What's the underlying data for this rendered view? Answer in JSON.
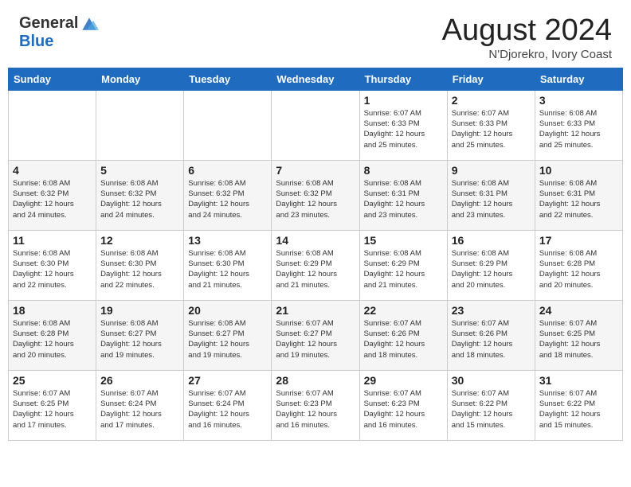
{
  "header": {
    "logo_general": "General",
    "logo_blue": "Blue",
    "month_title": "August 2024",
    "location": "N'Djorekro, Ivory Coast"
  },
  "days_of_week": [
    "Sunday",
    "Monday",
    "Tuesday",
    "Wednesday",
    "Thursday",
    "Friday",
    "Saturday"
  ],
  "weeks": [
    [
      {
        "day": "",
        "info": ""
      },
      {
        "day": "",
        "info": ""
      },
      {
        "day": "",
        "info": ""
      },
      {
        "day": "",
        "info": ""
      },
      {
        "day": "1",
        "info": "Sunrise: 6:07 AM\nSunset: 6:33 PM\nDaylight: 12 hours\nand 25 minutes."
      },
      {
        "day": "2",
        "info": "Sunrise: 6:07 AM\nSunset: 6:33 PM\nDaylight: 12 hours\nand 25 minutes."
      },
      {
        "day": "3",
        "info": "Sunrise: 6:08 AM\nSunset: 6:33 PM\nDaylight: 12 hours\nand 25 minutes."
      }
    ],
    [
      {
        "day": "4",
        "info": "Sunrise: 6:08 AM\nSunset: 6:32 PM\nDaylight: 12 hours\nand 24 minutes."
      },
      {
        "day": "5",
        "info": "Sunrise: 6:08 AM\nSunset: 6:32 PM\nDaylight: 12 hours\nand 24 minutes."
      },
      {
        "day": "6",
        "info": "Sunrise: 6:08 AM\nSunset: 6:32 PM\nDaylight: 12 hours\nand 24 minutes."
      },
      {
        "day": "7",
        "info": "Sunrise: 6:08 AM\nSunset: 6:32 PM\nDaylight: 12 hours\nand 23 minutes."
      },
      {
        "day": "8",
        "info": "Sunrise: 6:08 AM\nSunset: 6:31 PM\nDaylight: 12 hours\nand 23 minutes."
      },
      {
        "day": "9",
        "info": "Sunrise: 6:08 AM\nSunset: 6:31 PM\nDaylight: 12 hours\nand 23 minutes."
      },
      {
        "day": "10",
        "info": "Sunrise: 6:08 AM\nSunset: 6:31 PM\nDaylight: 12 hours\nand 22 minutes."
      }
    ],
    [
      {
        "day": "11",
        "info": "Sunrise: 6:08 AM\nSunset: 6:30 PM\nDaylight: 12 hours\nand 22 minutes."
      },
      {
        "day": "12",
        "info": "Sunrise: 6:08 AM\nSunset: 6:30 PM\nDaylight: 12 hours\nand 22 minutes."
      },
      {
        "day": "13",
        "info": "Sunrise: 6:08 AM\nSunset: 6:30 PM\nDaylight: 12 hours\nand 21 minutes."
      },
      {
        "day": "14",
        "info": "Sunrise: 6:08 AM\nSunset: 6:29 PM\nDaylight: 12 hours\nand 21 minutes."
      },
      {
        "day": "15",
        "info": "Sunrise: 6:08 AM\nSunset: 6:29 PM\nDaylight: 12 hours\nand 21 minutes."
      },
      {
        "day": "16",
        "info": "Sunrise: 6:08 AM\nSunset: 6:29 PM\nDaylight: 12 hours\nand 20 minutes."
      },
      {
        "day": "17",
        "info": "Sunrise: 6:08 AM\nSunset: 6:28 PM\nDaylight: 12 hours\nand 20 minutes."
      }
    ],
    [
      {
        "day": "18",
        "info": "Sunrise: 6:08 AM\nSunset: 6:28 PM\nDaylight: 12 hours\nand 20 minutes."
      },
      {
        "day": "19",
        "info": "Sunrise: 6:08 AM\nSunset: 6:27 PM\nDaylight: 12 hours\nand 19 minutes."
      },
      {
        "day": "20",
        "info": "Sunrise: 6:08 AM\nSunset: 6:27 PM\nDaylight: 12 hours\nand 19 minutes."
      },
      {
        "day": "21",
        "info": "Sunrise: 6:07 AM\nSunset: 6:27 PM\nDaylight: 12 hours\nand 19 minutes."
      },
      {
        "day": "22",
        "info": "Sunrise: 6:07 AM\nSunset: 6:26 PM\nDaylight: 12 hours\nand 18 minutes."
      },
      {
        "day": "23",
        "info": "Sunrise: 6:07 AM\nSunset: 6:26 PM\nDaylight: 12 hours\nand 18 minutes."
      },
      {
        "day": "24",
        "info": "Sunrise: 6:07 AM\nSunset: 6:25 PM\nDaylight: 12 hours\nand 18 minutes."
      }
    ],
    [
      {
        "day": "25",
        "info": "Sunrise: 6:07 AM\nSunset: 6:25 PM\nDaylight: 12 hours\nand 17 minutes."
      },
      {
        "day": "26",
        "info": "Sunrise: 6:07 AM\nSunset: 6:24 PM\nDaylight: 12 hours\nand 17 minutes."
      },
      {
        "day": "27",
        "info": "Sunrise: 6:07 AM\nSunset: 6:24 PM\nDaylight: 12 hours\nand 16 minutes."
      },
      {
        "day": "28",
        "info": "Sunrise: 6:07 AM\nSunset: 6:23 PM\nDaylight: 12 hours\nand 16 minutes."
      },
      {
        "day": "29",
        "info": "Sunrise: 6:07 AM\nSunset: 6:23 PM\nDaylight: 12 hours\nand 16 minutes."
      },
      {
        "day": "30",
        "info": "Sunrise: 6:07 AM\nSunset: 6:22 PM\nDaylight: 12 hours\nand 15 minutes."
      },
      {
        "day": "31",
        "info": "Sunrise: 6:07 AM\nSunset: 6:22 PM\nDaylight: 12 hours\nand 15 minutes."
      }
    ]
  ]
}
